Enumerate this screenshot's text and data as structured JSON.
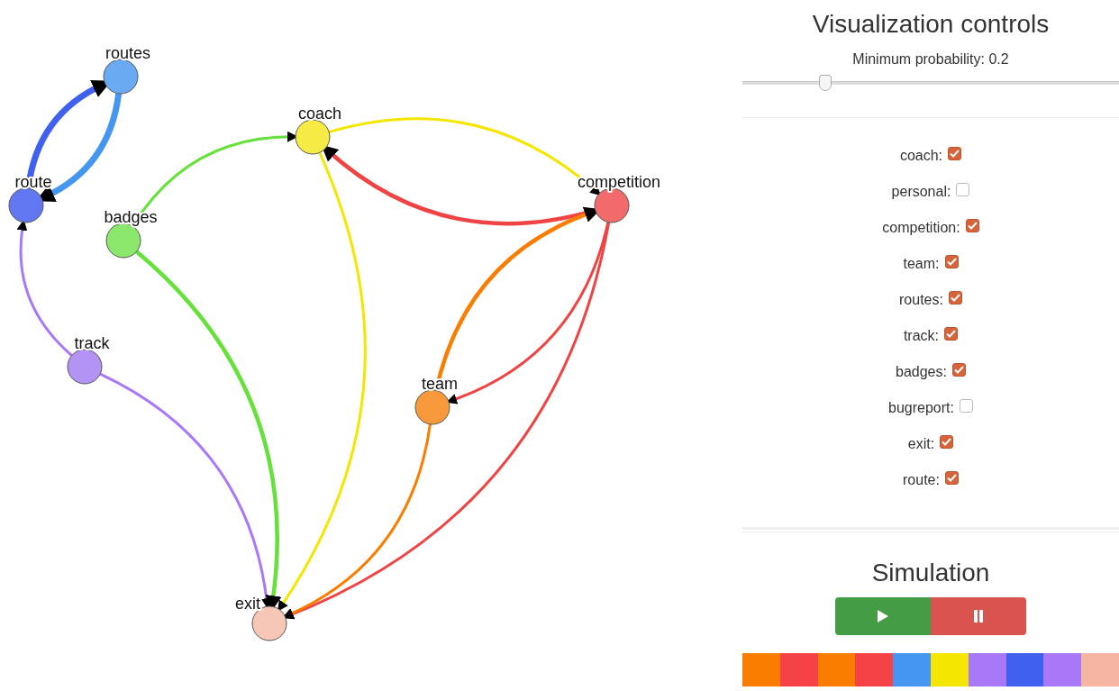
{
  "graph": {
    "nodes": [
      {
        "label": "routes",
        "color": "#6aaaf2"
      },
      {
        "label": "route",
        "color": "#6278f2"
      },
      {
        "label": "badges",
        "color": "#8be86c"
      },
      {
        "label": "track",
        "color": "#b394f5"
      },
      {
        "label": "coach",
        "color": "#f6ea45"
      },
      {
        "label": "competition",
        "color": "#f26a6a"
      },
      {
        "label": "team",
        "color": "#f89a3c"
      },
      {
        "label": "exit",
        "color": "#f6c6b6"
      }
    ],
    "edges": [
      {
        "color": "#4060f0",
        "kind": "thick"
      },
      {
        "color": "#4496f0",
        "kind": "thick"
      },
      {
        "color": "#a878f8",
        "kind": "thin"
      },
      {
        "color": "#a878f8",
        "kind": "thin"
      },
      {
        "color": "#66e03a",
        "kind": "thin"
      },
      {
        "color": "#66e03a",
        "kind": "medium"
      },
      {
        "color": "#f5e600",
        "kind": "thin"
      },
      {
        "color": "#f5e600",
        "kind": "thin"
      },
      {
        "color": "#f04444",
        "kind": "medium"
      },
      {
        "color": "#f04444",
        "kind": "thin"
      },
      {
        "color": "#f04444",
        "kind": "thin"
      },
      {
        "color": "#fa7d00",
        "kind": "medium"
      },
      {
        "color": "#fa7d00",
        "kind": "thin"
      }
    ]
  },
  "visualization_controls": {
    "title": "Visualization controls",
    "slider": {
      "label": "Minimum probability: 0.2",
      "level": 0.22
    },
    "filters": [
      {
        "label": "coach:",
        "checked": true
      },
      {
        "label": "personal:",
        "checked": false
      },
      {
        "label": "competition:",
        "checked": true
      },
      {
        "label": "team:",
        "checked": true
      },
      {
        "label": "routes:",
        "checked": true
      },
      {
        "label": "track:",
        "checked": true
      },
      {
        "label": "badges:",
        "checked": true
      },
      {
        "label": "bugreport:",
        "checked": false
      },
      {
        "label": "exit:",
        "checked": true
      },
      {
        "label": "route:",
        "checked": true
      }
    ]
  },
  "simulation": {
    "title": "Simulation",
    "buttons": [
      {
        "kind": "play"
      },
      {
        "kind": "pause"
      }
    ],
    "color_strip": [
      {
        "color": "#fa7d00"
      },
      {
        "color": "#f44246"
      },
      {
        "color": "#fa7d00"
      },
      {
        "color": "#f44246"
      },
      {
        "color": "#4496f0"
      },
      {
        "color": "#f5e600"
      },
      {
        "color": "#a878f8"
      },
      {
        "color": "#4060f0"
      },
      {
        "color": "#a878f8"
      },
      {
        "color": "#f5b5a2"
      }
    ]
  }
}
